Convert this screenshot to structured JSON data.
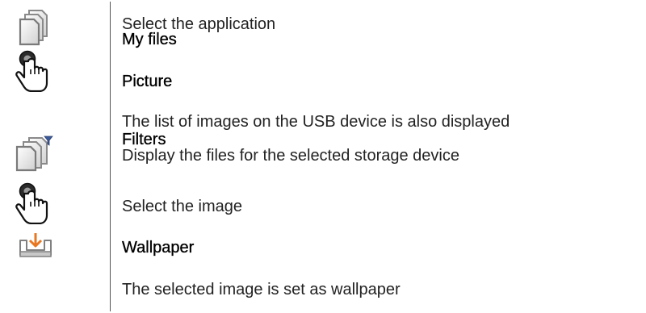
{
  "steps": [
    {
      "icon": "files-stack-icon",
      "text": "Select the application"
    },
    {
      "icon": "files-stack-icon",
      "text": "My files"
    },
    {
      "icon": "tap-hand-icon",
      "text": "Picture"
    },
    {
      "icon": "tap-hand-icon",
      "text": "The list of images on the USB device is also displayed"
    },
    {
      "icon": "files-filter-icon",
      "text": "Filters"
    },
    {
      "icon": "files-filter-icon",
      "text": "Display the files for the selected storage device"
    },
    {
      "icon": "tap-hand-icon",
      "text": "Select the image"
    },
    {
      "icon": "tray-download-icon",
      "text": "Wallpaper"
    },
    {
      "icon": "tray-download-icon",
      "text": "The selected image is set as wallpaper"
    }
  ],
  "colors": {
    "icon_gray": "#8a8a8a",
    "accent_orange": "#e87722",
    "filter_blue": "#3b5998"
  }
}
